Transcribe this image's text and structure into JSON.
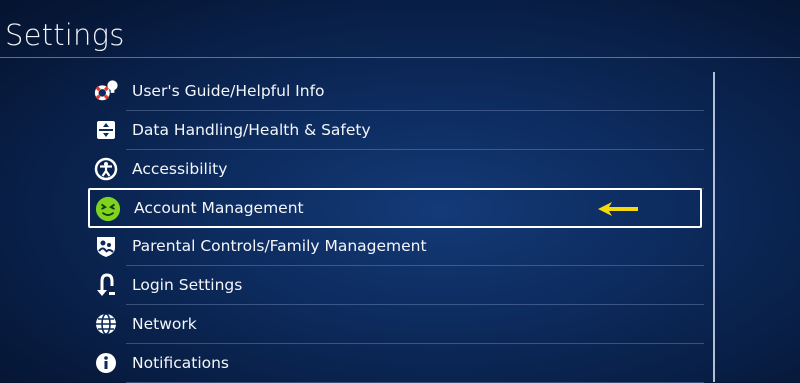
{
  "header": {
    "title": "Settings"
  },
  "menu": {
    "items": [
      {
        "label": "User's Guide/Helpful Info",
        "icon": "lifebuoy-lightbulb-icon"
      },
      {
        "label": "Data Handling/Health & Safety",
        "icon": "data-handling-icon"
      },
      {
        "label": "Accessibility",
        "icon": "accessibility-icon"
      },
      {
        "label": "Account Management",
        "icon": "account-smiley-icon",
        "selected": true,
        "accent": "#7ed321"
      },
      {
        "label": "Parental Controls/Family Management",
        "icon": "parental-controls-icon"
      },
      {
        "label": "Login Settings",
        "icon": "login-icon"
      },
      {
        "label": "Network",
        "icon": "globe-icon"
      },
      {
        "label": "Notifications",
        "icon": "info-icon"
      }
    ]
  },
  "colors": {
    "background": "#0c2a5c",
    "selection_border": "#ffffff",
    "arrow": "#f5d90a"
  }
}
